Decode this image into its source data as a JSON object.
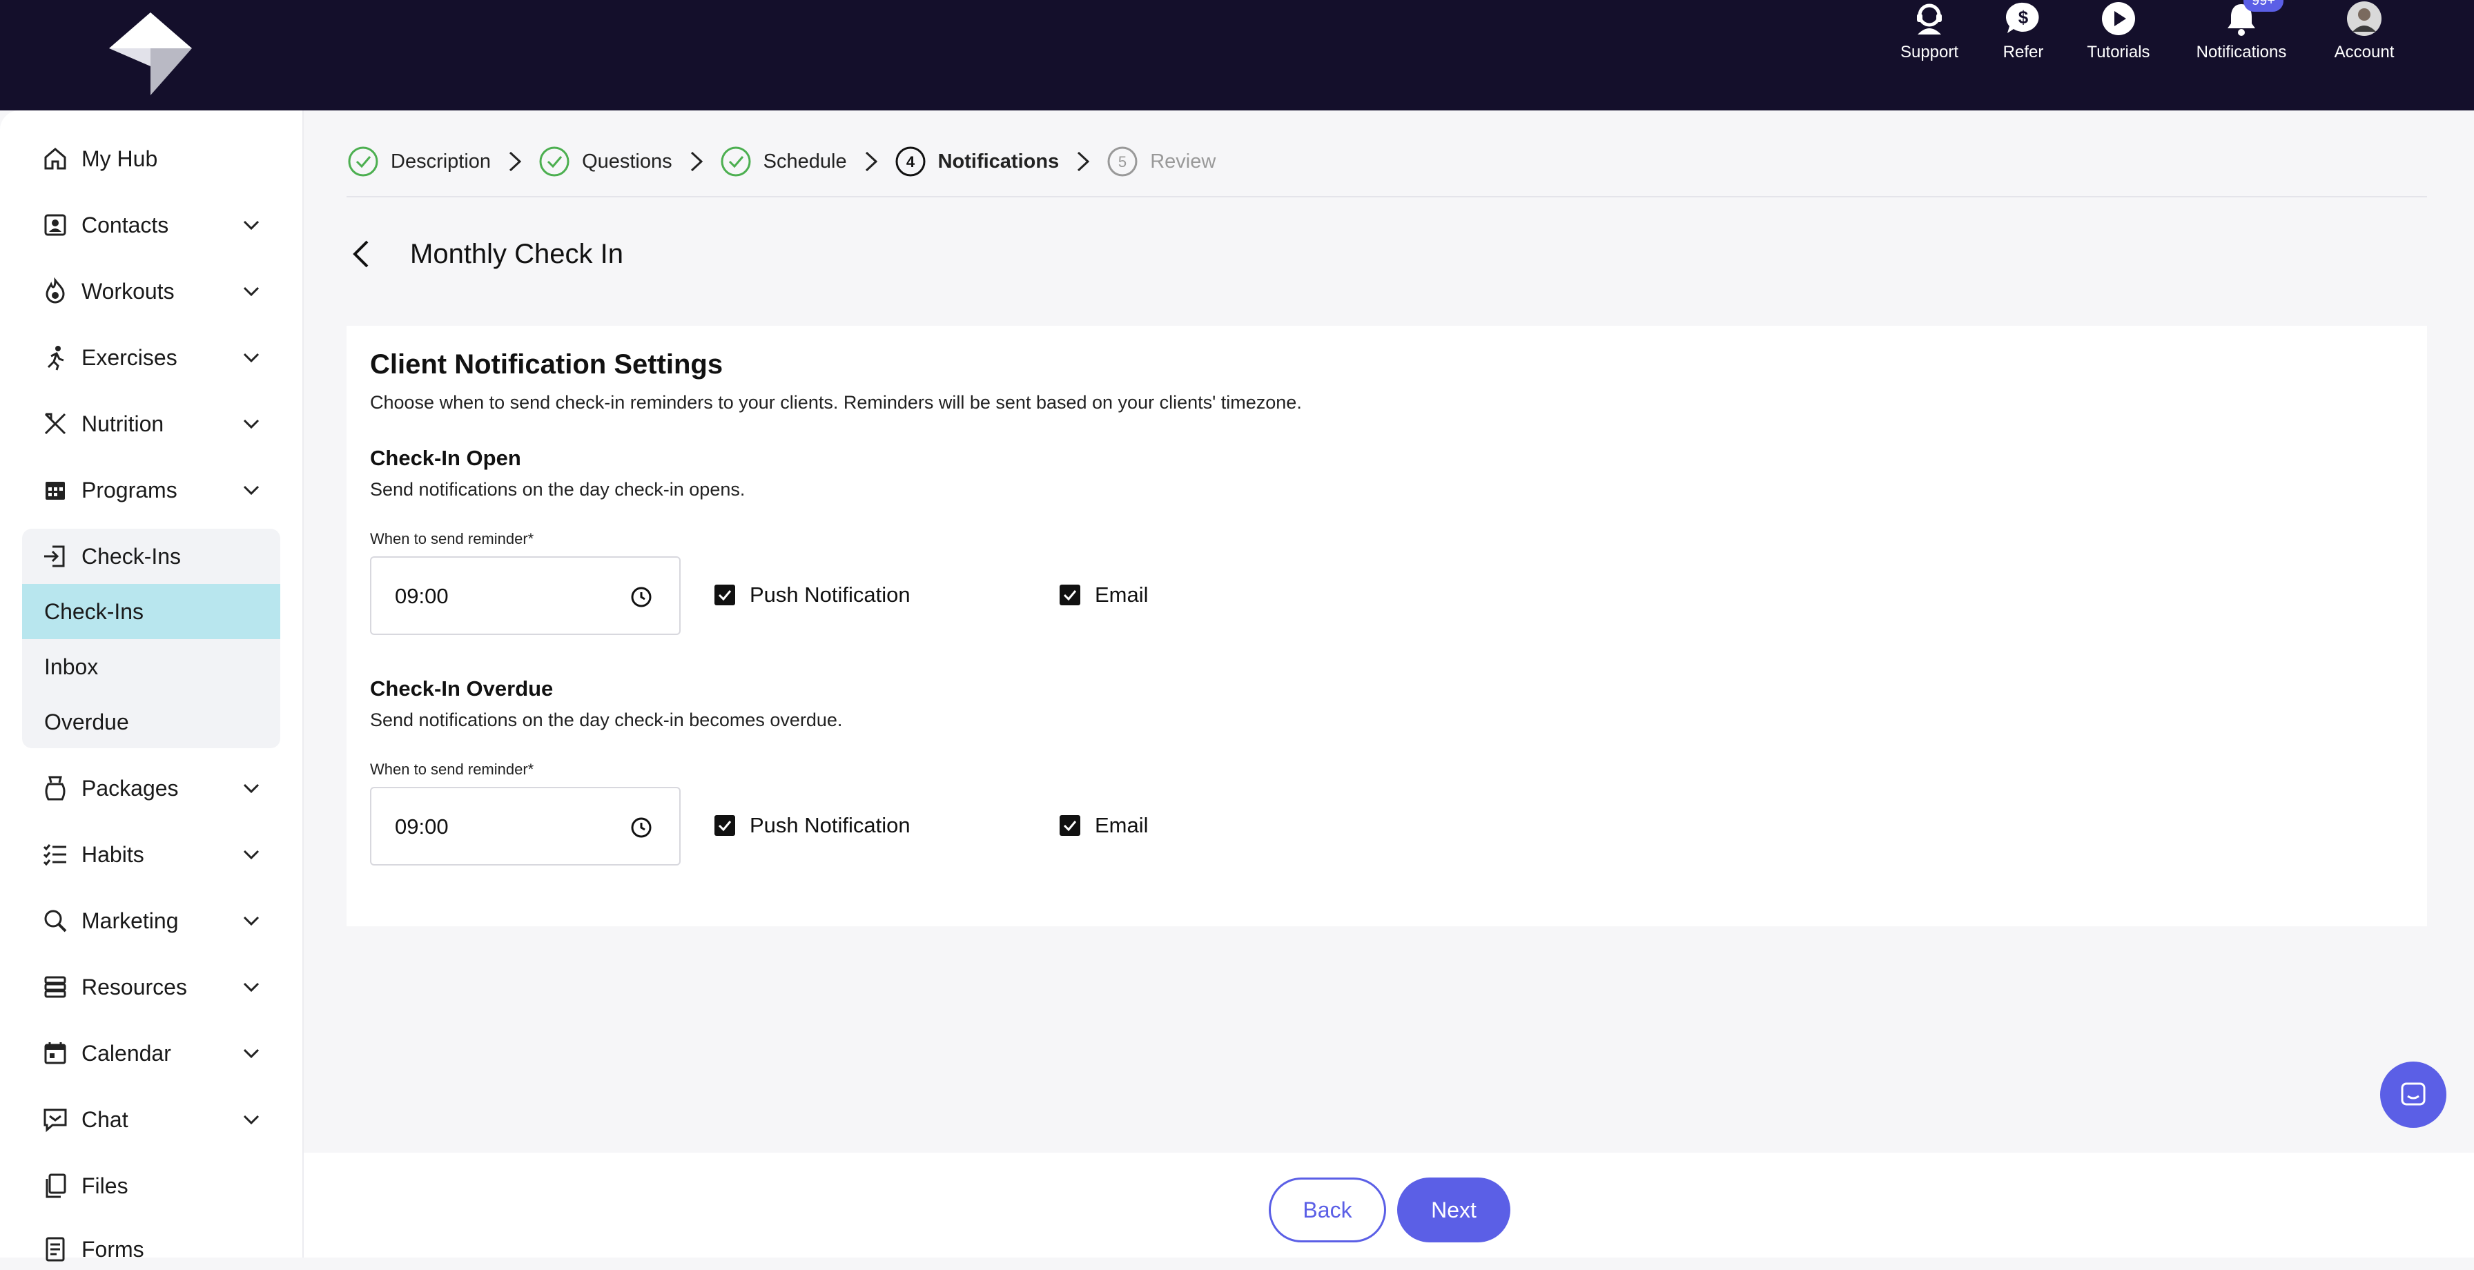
{
  "topbar": {
    "items": [
      {
        "label": "Support",
        "icon": "headset-icon"
      },
      {
        "label": "Refer",
        "icon": "dollar-chat-icon"
      },
      {
        "label": "Tutorials",
        "icon": "play-icon"
      },
      {
        "label": "Notifications",
        "icon": "bell-icon",
        "badge": "99+"
      },
      {
        "label": "Account",
        "icon": "avatar-icon"
      }
    ]
  },
  "sidebar": {
    "items": [
      {
        "label": "My Hub",
        "icon": "home-icon"
      },
      {
        "label": "Contacts",
        "icon": "contacts-icon"
      },
      {
        "label": "Workouts",
        "icon": "fire-icon"
      },
      {
        "label": "Exercises",
        "icon": "runner-icon"
      },
      {
        "label": "Nutrition",
        "icon": "utensils-icon"
      },
      {
        "label": "Programs",
        "icon": "calendar-grid-icon"
      },
      {
        "label": "Check-Ins",
        "icon": "sign-in-icon"
      },
      {
        "label": "Packages",
        "icon": "bag-icon"
      },
      {
        "label": "Habits",
        "icon": "checklist-icon"
      },
      {
        "label": "Marketing",
        "icon": "search-icon"
      },
      {
        "label": "Resources",
        "icon": "stack-icon"
      },
      {
        "label": "Calendar",
        "icon": "calendar-icon"
      },
      {
        "label": "Chat",
        "icon": "chat-icon"
      },
      {
        "label": "Files",
        "icon": "files-icon"
      },
      {
        "label": "Forms",
        "icon": "forms-icon"
      }
    ],
    "sub_items": [
      {
        "label": "Check-Ins",
        "active": true
      },
      {
        "label": "Inbox"
      },
      {
        "label": "Overdue"
      }
    ]
  },
  "stepper": {
    "steps": [
      {
        "label": "Description",
        "state": "done"
      },
      {
        "label": "Questions",
        "state": "done"
      },
      {
        "label": "Schedule",
        "state": "done"
      },
      {
        "label": "Notifications",
        "state": "current",
        "number": "4"
      },
      {
        "label": "Review",
        "state": "future",
        "number": "5"
      }
    ]
  },
  "page": {
    "title": "Monthly Check In"
  },
  "card": {
    "title": "Client Notification Settings",
    "description": "Choose when to send check-in reminders to your clients. Reminders will be sent based on your clients' timezone.",
    "sections": [
      {
        "title": "Check-In Open",
        "description": "Send notifications on the day check-in opens.",
        "field_label": "When to send reminder*",
        "time": "09:00",
        "push_label": "Push Notification",
        "push_checked": true,
        "email_label": "Email",
        "email_checked": true
      },
      {
        "title": "Check-In Overdue",
        "description": "Send notifications on the day check-in becomes overdue.",
        "field_label": "When to send reminder*",
        "time": "09:00",
        "push_label": "Push Notification",
        "push_checked": true,
        "email_label": "Email",
        "email_checked": true
      }
    ]
  },
  "footer": {
    "back_label": "Back",
    "next_label": "Next"
  },
  "colors": {
    "topbar": "#140f2b",
    "accent": "#5b5fe6",
    "active_sub": "#b8e6ee",
    "done_step": "#4caf50"
  }
}
